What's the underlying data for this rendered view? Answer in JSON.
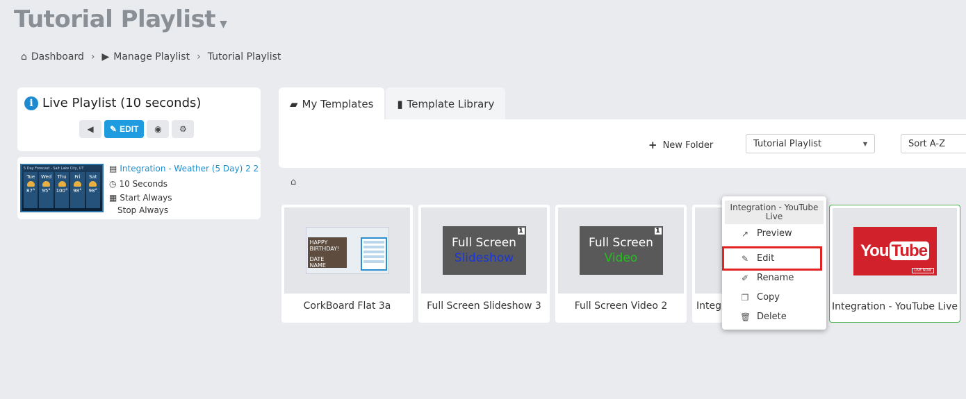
{
  "page_title": "Tutorial Playlist",
  "breadcrumb": {
    "dashboard": "Dashboard",
    "manage": "Manage Playlist",
    "current": "Tutorial Playlist"
  },
  "live_playlist": {
    "title": "Live Playlist (10 seconds)",
    "edit_label": "EDIT"
  },
  "playlist_item": {
    "name": "Integration - Weather (5 Day) 2 2",
    "duration": "10 Seconds",
    "start": "Start Always",
    "stop": "Stop Always",
    "thumb_header": "5 Day Forecast - Salt Lake City, UT",
    "days": [
      {
        "day": "Tue",
        "temp": "87°"
      },
      {
        "day": "Wed",
        "temp": "95°"
      },
      {
        "day": "Thu",
        "temp": "100°"
      },
      {
        "day": "Fri",
        "temp": "98°"
      },
      {
        "day": "Sat",
        "temp": "98°"
      }
    ]
  },
  "tabs": {
    "my_templates": "My Templates",
    "template_library": "Template Library"
  },
  "toolbar": {
    "new_folder": "New Folder",
    "folder_select": "Tutorial Playlist",
    "sort_select": "Sort A-Z"
  },
  "templates": [
    {
      "label": "CorkBoard Flat 3a",
      "bday_line1": "HAPPY",
      "bday_line2": "BIRTHDAY!",
      "bday_line3": "DATE",
      "bday_line4": "NAME"
    },
    {
      "label": "Full Screen Slideshow 3",
      "line1": "Full Screen",
      "line2": "Slideshow",
      "badge": "1",
      "line2_color": "#1a36d6"
    },
    {
      "label": "Full Screen Video 2",
      "line1": "Full Screen",
      "line2": "Video",
      "badge": "1",
      "line2_color": "#23c01f"
    },
    {
      "label": "Integ"
    },
    {
      "label": "Integration - YouTube Live",
      "yt_you": "You",
      "yt_tube": "Tube",
      "yt_live": "LIVE NOW"
    }
  ],
  "context_menu": {
    "title": "Integration - YouTube Live",
    "items": [
      "Preview",
      "Edit",
      "Rename",
      "Copy",
      "Delete"
    ]
  }
}
